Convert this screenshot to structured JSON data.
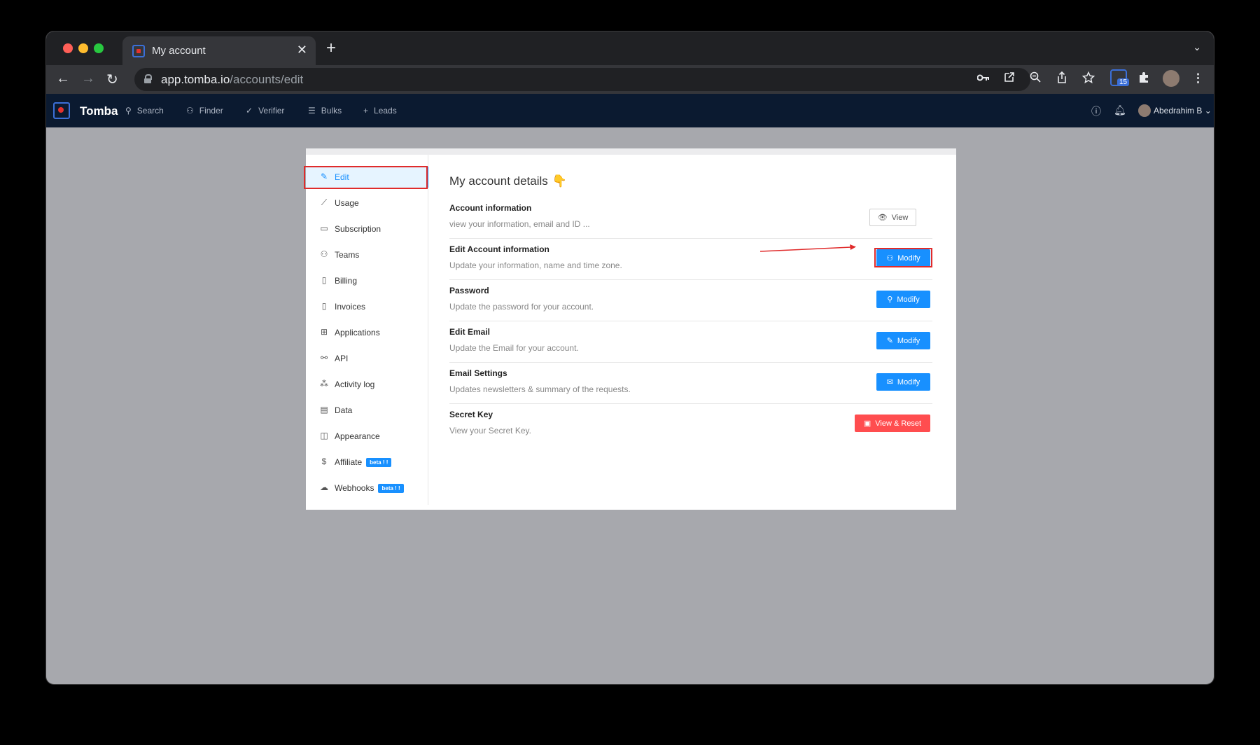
{
  "browser": {
    "tab_title": "My account",
    "tab_close": "✕",
    "new_tab": "+",
    "url_host": "app.tomba.io",
    "url_path": "/accounts/edit",
    "extension_badge": "15"
  },
  "appbar": {
    "brand": "Tomba",
    "nav": [
      {
        "label": "Search",
        "icon": "search-icon"
      },
      {
        "label": "Finder",
        "icon": "user-icon"
      },
      {
        "label": "Verifier",
        "icon": "check-icon"
      },
      {
        "label": "Bulks",
        "icon": "list-icon"
      },
      {
        "label": "Leads",
        "icon": "plus-icon"
      }
    ],
    "user_name": "Abedrahim B"
  },
  "sidebar": {
    "items": [
      {
        "label": "Edit",
        "icon": "edit-icon",
        "active": true
      },
      {
        "label": "Usage",
        "icon": "chart-line-icon"
      },
      {
        "label": "Subscription",
        "icon": "card-icon"
      },
      {
        "label": "Teams",
        "icon": "team-icon"
      },
      {
        "label": "Billing",
        "icon": "file-icon"
      },
      {
        "label": "Invoices",
        "icon": "document-icon"
      },
      {
        "label": "Applications",
        "icon": "apps-icon"
      },
      {
        "label": "API",
        "icon": "api-icon"
      },
      {
        "label": "Activity log",
        "icon": "cluster-icon"
      },
      {
        "label": "Data",
        "icon": "database-icon"
      },
      {
        "label": "Appearance",
        "icon": "layout-icon"
      },
      {
        "label": "Affiliate",
        "icon": "dollar-icon",
        "badge": "beta ! !"
      },
      {
        "label": "Webhooks",
        "icon": "cloud-icon",
        "badge": "beta ! !"
      }
    ]
  },
  "main": {
    "title": "My account details",
    "title_emoji": "👇",
    "rows": [
      {
        "title": "Account information",
        "desc": "view your information, email and ID ...",
        "button": "View",
        "button_icon": "eye-icon"
      },
      {
        "title": "Edit Account information",
        "desc": "Update your information, name and time zone.",
        "button": "Modify",
        "button_icon": "user-icon"
      },
      {
        "title": "Password",
        "desc": "Update the password for your account.",
        "button": "Modify",
        "button_icon": "key-icon"
      },
      {
        "title": "Edit Email",
        "desc": "Update the Email for your account.",
        "button": "Modify",
        "button_icon": "edit-icon"
      },
      {
        "title": "Email Settings",
        "desc": "Updates newsletters & summary of the requests.",
        "button": "Modify",
        "button_icon": "mail-icon"
      },
      {
        "title": "Secret Key",
        "desc": "View your Secret Key.",
        "button": "View & Reset",
        "button_icon": "id-card-icon"
      }
    ]
  },
  "colors": {
    "primary": "#1890ff",
    "danger": "#ff4d4f",
    "highlight": "#e02b2b",
    "appbar": "#0b1a30"
  }
}
